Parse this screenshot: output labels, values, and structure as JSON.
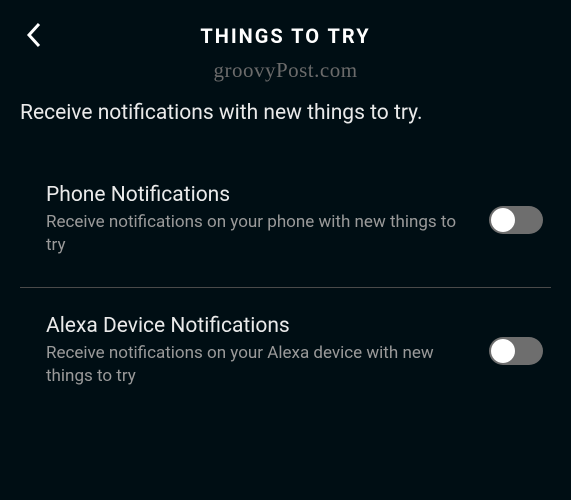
{
  "header": {
    "title": "THINGS TO TRY"
  },
  "watermark": "groovyPost.com",
  "page_description": "Receive notifications with new things to try.",
  "settings": [
    {
      "title": "Phone Notifications",
      "subtitle": "Receive notifications on your phone with new things to try",
      "enabled": false
    },
    {
      "title": "Alexa Device Notifications",
      "subtitle": "Receive notifications on your Alexa device with new things to try",
      "enabled": false
    }
  ]
}
